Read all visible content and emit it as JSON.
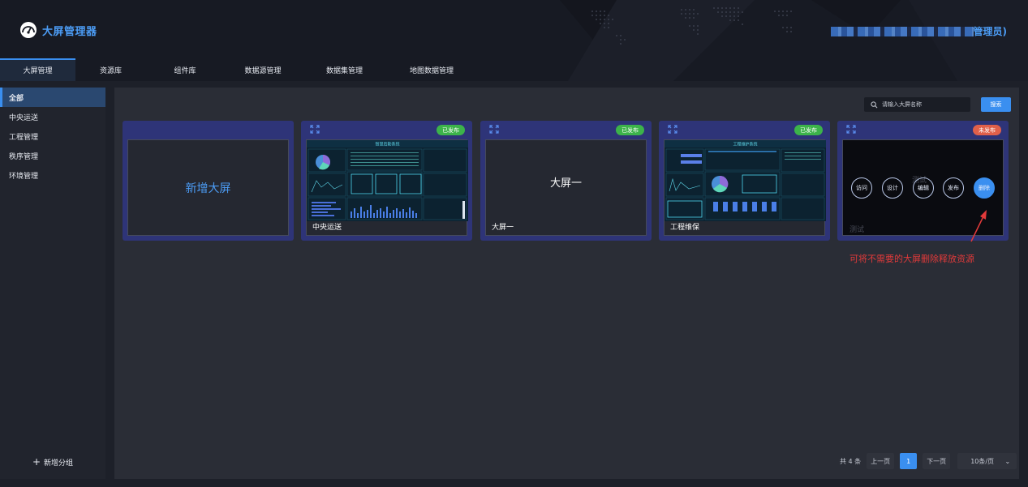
{
  "app": {
    "title": "大屏管理器",
    "user_role": "管理员)"
  },
  "nav": {
    "tabs": [
      {
        "label": "大屏管理"
      },
      {
        "label": "资源库"
      },
      {
        "label": "组件库"
      },
      {
        "label": "数据源管理"
      },
      {
        "label": "数据集管理"
      },
      {
        "label": "地图数据管理"
      }
    ]
  },
  "sidebar": {
    "items": [
      {
        "label": "全部"
      },
      {
        "label": "中央运送"
      },
      {
        "label": "工程管理"
      },
      {
        "label": "秩序管理"
      },
      {
        "label": "环境管理"
      }
    ],
    "add_label": "新增分组"
  },
  "search": {
    "placeholder": "请输入大屏名称",
    "button_label": "搜索"
  },
  "cards": {
    "new_label": "新增大屏",
    "items": [
      {
        "name": "中央运送",
        "status": "已发布",
        "preview_title": "智慧后勤系统"
      },
      {
        "name": "大屏一",
        "status": "已发布",
        "center_title": "大屏一"
      },
      {
        "name": "工程维保",
        "status": "已发布",
        "preview_title": "工程维护系统"
      },
      {
        "name": "测试",
        "status": "未发布",
        "ghost_title": "测试",
        "actions": [
          "访问",
          "设计",
          "编辑",
          "发布",
          "删除"
        ]
      }
    ]
  },
  "annotation": "可将不需要的大屏删除释放资源",
  "pagination": {
    "total": "共 4 条",
    "prev": "上一页",
    "page": "1",
    "next": "下一页",
    "page_size": "10条/页"
  },
  "colors": {
    "accent": "#3a8ff0",
    "published": "#3cb34a",
    "unpublished": "#e0604a",
    "annotation": "#e23a3a",
    "card_frame": "#2e3478"
  }
}
